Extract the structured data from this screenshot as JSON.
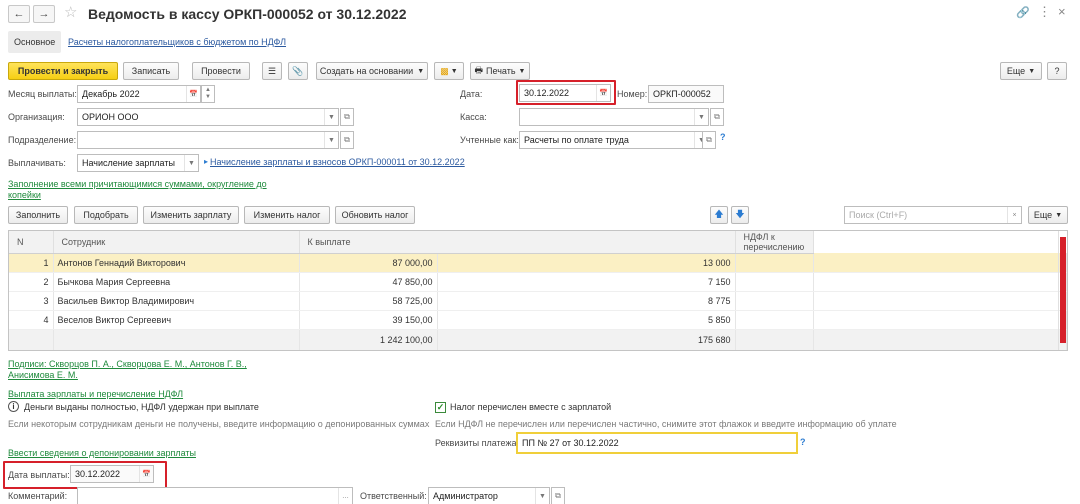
{
  "window": {
    "title": "Ведомость в кассу ОРКП-000052 от 30.12.2022"
  },
  "tabs": [
    {
      "label": "Основное"
    },
    {
      "label": "Расчеты налогоплательщиков с бюджетом по НДФЛ"
    }
  ],
  "toolbar": {
    "post_close": "Провести и закрыть",
    "save": "Записать",
    "post": "Провести",
    "create_based": "Создать на основании",
    "print": "Печать",
    "more": "Еще",
    "help": "?"
  },
  "form": {
    "month_label": "Месяц выплаты:",
    "month_value": "Декабрь 2022",
    "date_label": "Дата:",
    "date_value": "30.12.2022",
    "number_label": "Номер:",
    "number_value": "ОРКП-000052",
    "org_label": "Организация:",
    "org_value": "ОРИОН ООО",
    "kassa_label": "Касса:",
    "kassa_value": "",
    "division_label": "Подразделение:",
    "division_value": "",
    "accounted_label": "Учтенные как:",
    "accounted_value": "Расчеты по оплате труда",
    "pay_label": "Выплачивать:",
    "pay_value": "Начисление зарплаты",
    "pay_doc_link": "Начисление зарплаты и взносов ОРКП-000011 от 30.12.2022",
    "fill_link": "Заполнение всеми причитающимися суммами, округление до копейки"
  },
  "grid_toolbar": {
    "fill": "Заполнить",
    "select": "Подобрать",
    "change_salary": "Изменить зарплату",
    "change_tax": "Изменить налог",
    "update_tax": "Обновить налог",
    "search_placeholder": "Поиск (Ctrl+F)",
    "more": "Еще"
  },
  "table": {
    "headers": [
      "N",
      "Сотрудник",
      "К выплате",
      "НДФЛ к перечислению"
    ],
    "rows": [
      {
        "n": "1",
        "employee": "Антонов Геннадий Викторович",
        "amount": "87 000,00",
        "ndfl": "13 000"
      },
      {
        "n": "2",
        "employee": "Бычкова Мария Сергеевна",
        "amount": "47 850,00",
        "ndfl": "7 150"
      },
      {
        "n": "3",
        "employee": "Васильев Виктор Владимирович",
        "amount": "58 725,00",
        "ndfl": "8 775"
      },
      {
        "n": "4",
        "employee": "Веселов Виктор Сергеевич",
        "amount": "39 150,00",
        "ndfl": "5 850"
      }
    ],
    "total_amount": "1 242 100,00",
    "total_ndfl": "175 680"
  },
  "bottom": {
    "signatures_link_1": "Подписи: Скворцов П. А., Скворцова Е. М., Антонов Г. В.,",
    "signatures_link_2": "Анисимова Е. М.",
    "payment_section_link": "Выплата зарплаты и перечисление НДФЛ",
    "paid_info": "Деньги выданы полностью, НДФЛ удержан при выплате",
    "paid_note": "Если некоторым сотрудникам деньги не получены, введите информацию о депонированных суммах",
    "tax_paid_label": "Налог перечислен вместе с зарплатой",
    "tax_note": "Если НДФЛ не перечислен или перечислен частично, снимите этот флажок и введите информацию об уплате",
    "payment_details_label": "Реквизиты платежа:",
    "payment_details_value": "ПП № 27 от 30.12.2022",
    "deposit_link": "Ввести сведения о депонировании зарплаты",
    "pay_date_label": "Дата выплаты:",
    "pay_date_value": "30.12.2022",
    "comment_label": "Комментарий:",
    "responsible_label": "Ответственный:",
    "responsible_value": "Администратор"
  },
  "colors": {
    "accent_yellow": "#f6cf14",
    "highlight_red": "#d6202a",
    "link_green": "#1f8a3c",
    "link_blue": "#2c5aa0",
    "selected_row": "#fbf0c4"
  }
}
